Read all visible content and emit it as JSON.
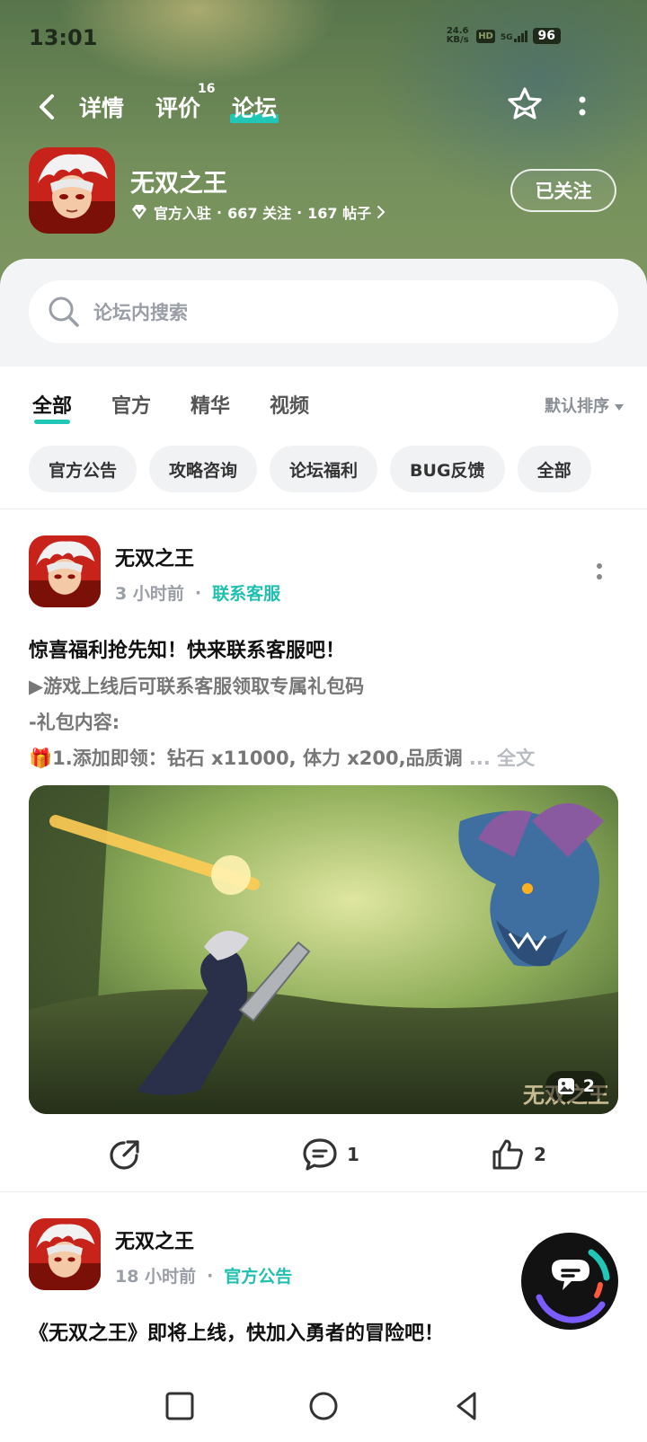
{
  "status_bar": {
    "time": "13:01",
    "net_speed_value": "24.6",
    "net_speed_unit": "KB/s",
    "hd_label": "HD",
    "signal_label": "5G",
    "battery": "96"
  },
  "top_nav": {
    "tabs": [
      {
        "label": "详情"
      },
      {
        "label": "评价",
        "badge": "16"
      },
      {
        "label": "论坛",
        "active": true
      }
    ]
  },
  "game": {
    "name": "无双之王",
    "verified_label": "官方入驻",
    "followers": "667 关注",
    "posts": "167 帖子",
    "follow_button": "已关注"
  },
  "search": {
    "placeholder": "论坛内搜索"
  },
  "filter_tabs": [
    {
      "label": "全部",
      "active": true
    },
    {
      "label": "官方"
    },
    {
      "label": "精华"
    },
    {
      "label": "视频"
    }
  ],
  "sort_label": "默认排序",
  "chips": [
    "官方公告",
    "攻略咨询",
    "论坛福利",
    "BUG反馈",
    "全部"
  ],
  "posts": [
    {
      "author": "无双之王",
      "time": "3 小时前",
      "tag": "联系客服",
      "title": "惊喜福利抢先知！快来联系客服吧！",
      "lines": [
        "▶游戏上线后可联系客服领取专属礼包码",
        "-礼包内容:",
        "🎁1.添加即领：钻石 x11000, 体力 x200,品质调"
      ],
      "ellipsis": " ... ",
      "more_label": "全文",
      "image_count": "2",
      "image_watermark": "无双之王",
      "comments": "1",
      "likes": "2"
    },
    {
      "author": "无双之王",
      "time": "18 小时前",
      "tag": "官方公告",
      "title": "《无双之王》即将上线，快加入勇者的冒险吧！"
    }
  ],
  "colors": {
    "accent": "#20c6b6",
    "hero_green": "#6f8b58"
  }
}
